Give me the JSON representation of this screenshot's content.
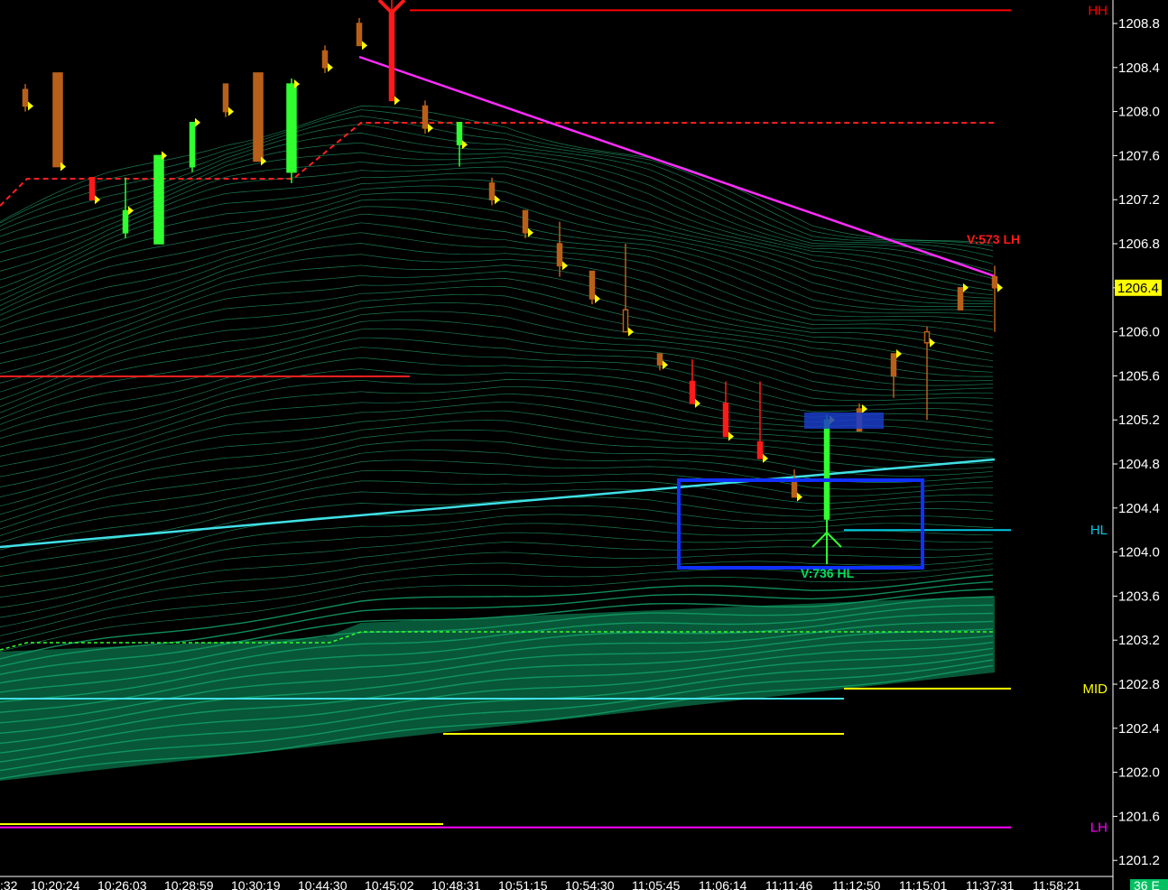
{
  "chart_data": {
    "type": "candlestick",
    "price_axis": {
      "ylim": [
        1201.08,
        1209.1
      ],
      "ticks": [
        "1208.8",
        "1208.4",
        "1208.0",
        "1207.6",
        "1207.2",
        "1206.8",
        "1206.4",
        "1206.0",
        "1205.6",
        "1205.2",
        "1204.8",
        "1204.4",
        "1204.0",
        "1203.6",
        "1203.2",
        "1202.8",
        "1202.4",
        "1202.0",
        "1201.6",
        "1201.2"
      ],
      "current_price": "1206.4",
      "current_price_color": "#ffff00"
    },
    "time_axis": {
      "ticks": [
        ":32",
        "10:20:24",
        "10:26:03",
        "10:28:59",
        "10:30:19",
        "10:44:30",
        "10:45:02",
        "10:48:31",
        "10:51:15",
        "10:54:30",
        "11:05:45",
        "11:06:14",
        "11:11:46",
        "11:12:50",
        "11:15:01",
        "11:37:31",
        "11:58:21"
      ],
      "corner_label": "36 E"
    },
    "levels": [
      {
        "label": "HH",
        "color": "#ff0000",
        "value": 1208.92
      },
      {
        "label": "HL",
        "color": "#00c8e6",
        "value": 1204.2
      },
      {
        "label": "MID",
        "color": "#ffff00",
        "value": 1202.76
      },
      {
        "label": "LH",
        "color": "#ff00ff",
        "value": 1201.5
      }
    ],
    "annotations": [
      {
        "text": "V:573 LH",
        "color": "#ff1a1a"
      },
      {
        "text": "V:736 HL",
        "color": "#00e060"
      }
    ],
    "candles": [
      {
        "o": 1208.2,
        "h": 1208.25,
        "l": 1208.0,
        "c": 1208.05,
        "color": "brown"
      },
      {
        "o": 1208.35,
        "h": 1208.35,
        "l": 1207.5,
        "c": 1207.5,
        "color": "brown"
      },
      {
        "o": 1207.4,
        "h": 1207.4,
        "l": 1207.2,
        "c": 1207.2,
        "color": "red"
      },
      {
        "o": 1206.9,
        "h": 1207.4,
        "l": 1206.85,
        "c": 1207.1,
        "color": "green"
      },
      {
        "o": 1206.8,
        "h": 1207.6,
        "l": 1206.8,
        "c": 1207.6,
        "color": "green"
      },
      {
        "o": 1207.5,
        "h": 1207.9,
        "l": 1207.45,
        "c": 1207.9,
        "color": "green"
      },
      {
        "o": 1208.25,
        "h": 1208.25,
        "l": 1207.95,
        "c": 1208.0,
        "color": "brown"
      },
      {
        "o": 1208.35,
        "h": 1208.35,
        "l": 1207.55,
        "c": 1207.55,
        "color": "brown"
      },
      {
        "o": 1207.45,
        "h": 1208.3,
        "l": 1207.35,
        "c": 1208.25,
        "color": "green"
      },
      {
        "o": 1208.55,
        "h": 1208.6,
        "l": 1208.35,
        "c": 1208.4,
        "color": "brown"
      },
      {
        "o": 1208.8,
        "h": 1208.85,
        "l": 1208.6,
        "c": 1208.6,
        "color": "brown"
      },
      {
        "o": 1208.9,
        "h": 1209.1,
        "l": 1208.1,
        "c": 1208.1,
        "color": "red"
      },
      {
        "o": 1208.05,
        "h": 1208.1,
        "l": 1207.8,
        "c": 1207.85,
        "color": "brown"
      },
      {
        "o": 1207.9,
        "h": 1207.9,
        "l": 1207.5,
        "c": 1207.7,
        "color": "green"
      },
      {
        "o": 1207.35,
        "h": 1207.4,
        "l": 1207.15,
        "c": 1207.2,
        "color": "brown"
      },
      {
        "o": 1207.1,
        "h": 1207.1,
        "l": 1206.85,
        "c": 1206.9,
        "color": "brown"
      },
      {
        "o": 1206.8,
        "h": 1207.0,
        "l": 1206.5,
        "c": 1206.6,
        "color": "brown"
      },
      {
        "o": 1206.55,
        "h": 1206.55,
        "l": 1206.25,
        "c": 1206.3,
        "color": "brown"
      },
      {
        "o": 1206.2,
        "h": 1206.8,
        "l": 1206.0,
        "c": 1206.0,
        "color": "brown"
      },
      {
        "o": 1205.8,
        "h": 1205.8,
        "l": 1205.65,
        "c": 1205.7,
        "color": "brown"
      },
      {
        "o": 1205.55,
        "h": 1205.75,
        "l": 1205.35,
        "c": 1205.35,
        "color": "red"
      },
      {
        "o": 1205.35,
        "h": 1205.55,
        "l": 1205.05,
        "c": 1205.05,
        "color": "red"
      },
      {
        "o": 1205.0,
        "h": 1205.55,
        "l": 1204.85,
        "c": 1204.85,
        "color": "red"
      },
      {
        "o": 1204.65,
        "h": 1204.75,
        "l": 1204.5,
        "c": 1204.5,
        "color": "brown"
      },
      {
        "o": 1204.3,
        "h": 1205.25,
        "l": 1204.3,
        "c": 1205.2,
        "color": "green"
      },
      {
        "o": 1205.1,
        "h": 1205.35,
        "l": 1205.1,
        "c": 1205.3,
        "color": "brown"
      },
      {
        "o": 1205.6,
        "h": 1205.8,
        "l": 1205.4,
        "c": 1205.8,
        "color": "brown"
      },
      {
        "o": 1206.0,
        "h": 1206.05,
        "l": 1205.2,
        "c": 1205.9,
        "color": "brown"
      },
      {
        "o": 1206.2,
        "h": 1206.4,
        "l": 1206.2,
        "c": 1206.4,
        "color": "brown"
      },
      {
        "o": 1206.5,
        "h": 1206.6,
        "l": 1206.0,
        "c": 1206.4,
        "color": "brown"
      }
    ]
  }
}
